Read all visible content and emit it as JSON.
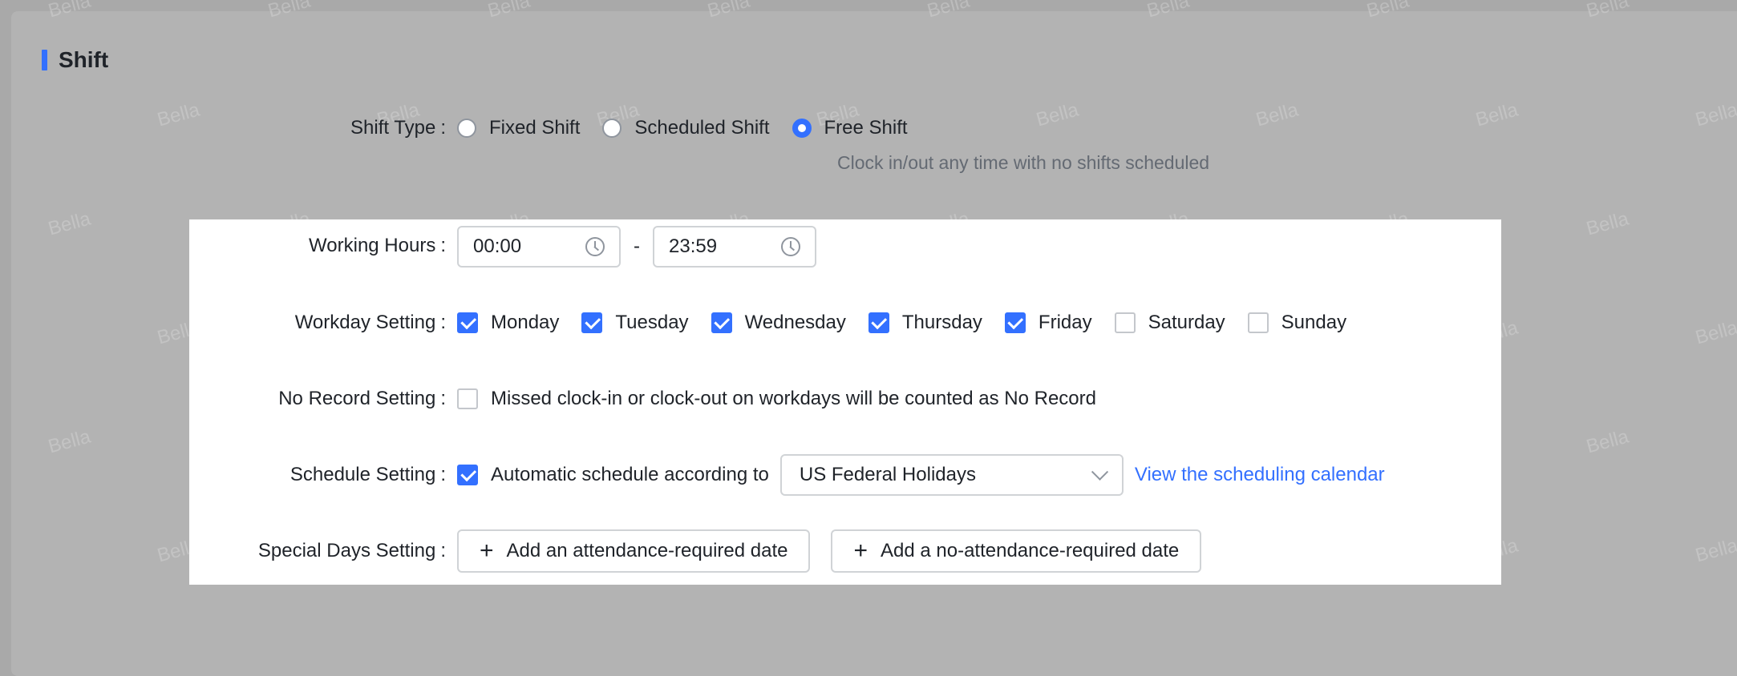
{
  "section": {
    "title": "Shift"
  },
  "watermark_text": "Bella",
  "shift_type": {
    "label": "Shift Type",
    "options": [
      "Fixed Shift",
      "Scheduled Shift",
      "Free Shift"
    ],
    "selected": "Free Shift",
    "hint": "Clock in/out any time with no shifts scheduled"
  },
  "working_hours": {
    "label": "Working Hours",
    "start": "00:00",
    "separator": "-",
    "end": "23:59"
  },
  "workday": {
    "label": "Workday Setting",
    "days": [
      {
        "name": "Monday",
        "checked": true
      },
      {
        "name": "Tuesday",
        "checked": true
      },
      {
        "name": "Wednesday",
        "checked": true
      },
      {
        "name": "Thursday",
        "checked": true
      },
      {
        "name": "Friday",
        "checked": true
      },
      {
        "name": "Saturday",
        "checked": false
      },
      {
        "name": "Sunday",
        "checked": false
      }
    ]
  },
  "no_record": {
    "label": "No Record Setting",
    "checked": false,
    "text": "Missed clock-in or clock-out on workdays will be counted as No Record"
  },
  "schedule": {
    "label": "Schedule Setting",
    "checked": true,
    "text": "Automatic schedule according to",
    "select_value": "US Federal Holidays",
    "link": "View the scheduling calendar"
  },
  "special_days": {
    "label": "Special Days Setting",
    "add_required": "Add an attendance-required date",
    "add_not_required": "Add a no-attendance-required date"
  },
  "colors": {
    "accent": "#3370ff",
    "overlay": "#b3b3b3"
  }
}
